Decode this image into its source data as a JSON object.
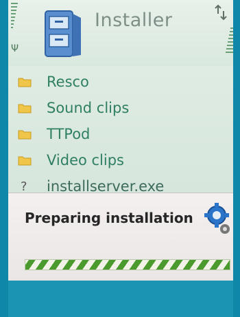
{
  "header": {
    "title": "Installer",
    "app_icon": "installer-icon",
    "status_icon": "data-transfer-icon"
  },
  "list": {
    "items": [
      {
        "label": "Resco",
        "icon": "folder-icon"
      },
      {
        "label": "Sound clips",
        "icon": "folder-icon"
      },
      {
        "label": "TTPod",
        "icon": "folder-icon"
      },
      {
        "label": "Video clips",
        "icon": "folder-icon"
      },
      {
        "label": "installserver.exe",
        "icon": "unknown-file-icon"
      }
    ]
  },
  "dialog": {
    "message": "Preparing installation",
    "icon": "gear-icon",
    "progress": "indeterminate"
  },
  "colors": {
    "background": "#dfece3",
    "accent": "#1a9cc0",
    "list_text": "#2f7f63",
    "progress_green": "#4a9a2e"
  }
}
